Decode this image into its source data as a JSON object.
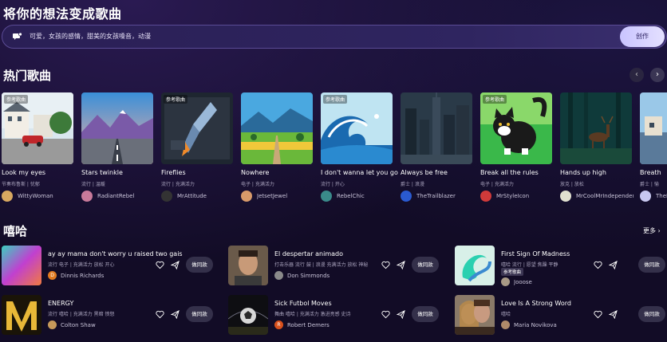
{
  "page_title": "将你的想法变成歌曲",
  "prompt": {
    "text": "可爱，女孩的感情，甜美的女孩嗓音，动漫",
    "create_label": "创作"
  },
  "hot_songs": {
    "title": "热门歌曲",
    "items": [
      {
        "badge": "参考歌曲",
        "title": "Look my eyes",
        "tags": "节奏布鲁斯 | 忧郁",
        "author": "WittyWoman"
      },
      {
        "badge": "",
        "title": "Stars twinkle",
        "tags": "流行 | 温暖",
        "author": "RadiantRebel"
      },
      {
        "badge": "参考歌曲",
        "title": "Fireflies",
        "tags": "流行 | 充满活力",
        "author": "MrAttitude"
      },
      {
        "badge": "",
        "title": "Nowhere",
        "tags": "电子 | 充满活力",
        "author": "JetsetJewel"
      },
      {
        "badge": "参考歌曲",
        "title": "I don't wanna let you go",
        "tags": "流行 | 开心",
        "author": "RebelChic"
      },
      {
        "badge": "",
        "title": "Always be free",
        "tags": "爵士 | 浪漫",
        "author": "TheTrailblazer"
      },
      {
        "badge": "参考歌曲",
        "title": "Break all the rules",
        "tags": "电子 | 充满活力",
        "author": "MrStyleIcon"
      },
      {
        "badge": "",
        "title": "Hands up high",
        "tags": "放克 | 放松",
        "author": "MrCoolMrIndependent"
      },
      {
        "badge": "",
        "title": "Breath",
        "tags": "爵士 | 愉",
        "author": "TheI"
      }
    ]
  },
  "hiphop": {
    "title": "嘻哈",
    "more_label": "更多 ›",
    "same_label": "做同款",
    "items": [
      {
        "title": "ay ay mama don't worry u raised two gais",
        "tags": "流行 电子 | 充满活力 放松 开心",
        "badge": "",
        "author": "Dinnis Richards",
        "avatar_letter": "D",
        "avatar_color": "#e07a1f"
      },
      {
        "title": "El despertar animado",
        "tags": "打击乐器 流行 鼓 | 浪漫 充满活力 放松 神秘",
        "badge": "",
        "author": "Don Simmonds",
        "avatar_letter": "",
        "avatar_color": "#8a8a8a"
      },
      {
        "title": "First Sign Of Madness",
        "tags": "嘻哈 流行 | 愿望 焦躁 平静",
        "badge": "参考歌曲",
        "author": "Jooose",
        "avatar_letter": "",
        "avatar_color": "#a89a86"
      },
      {
        "title": "ENERGY",
        "tags": "流行 嘻哈 | 充满活力 黑暗 愤怒",
        "badge": "",
        "author": "Colton Shaw",
        "avatar_letter": "",
        "avatar_color": "#c79a5a"
      },
      {
        "title": "Sick Futbol Moves",
        "tags": "舞曲 嘻哈 | 充满活力 激进亮感 史诗",
        "badge": "",
        "author": "Robert Demers",
        "avatar_letter": "R",
        "avatar_color": "#d8501c"
      },
      {
        "title": "Love Is A Strong Word",
        "tags": "嘻哈",
        "badge": "",
        "author": "Maria Novikova",
        "avatar_letter": "",
        "avatar_color": "#b08a6a"
      }
    ]
  },
  "colors": {
    "background": "#120c26",
    "accent": "#d7d2ff",
    "tag_text": "#a9a3bd"
  },
  "icons": [
    "chat-bubble-icon",
    "chevron-left-icon",
    "chevron-right-icon",
    "heart-icon",
    "share-icon"
  ]
}
